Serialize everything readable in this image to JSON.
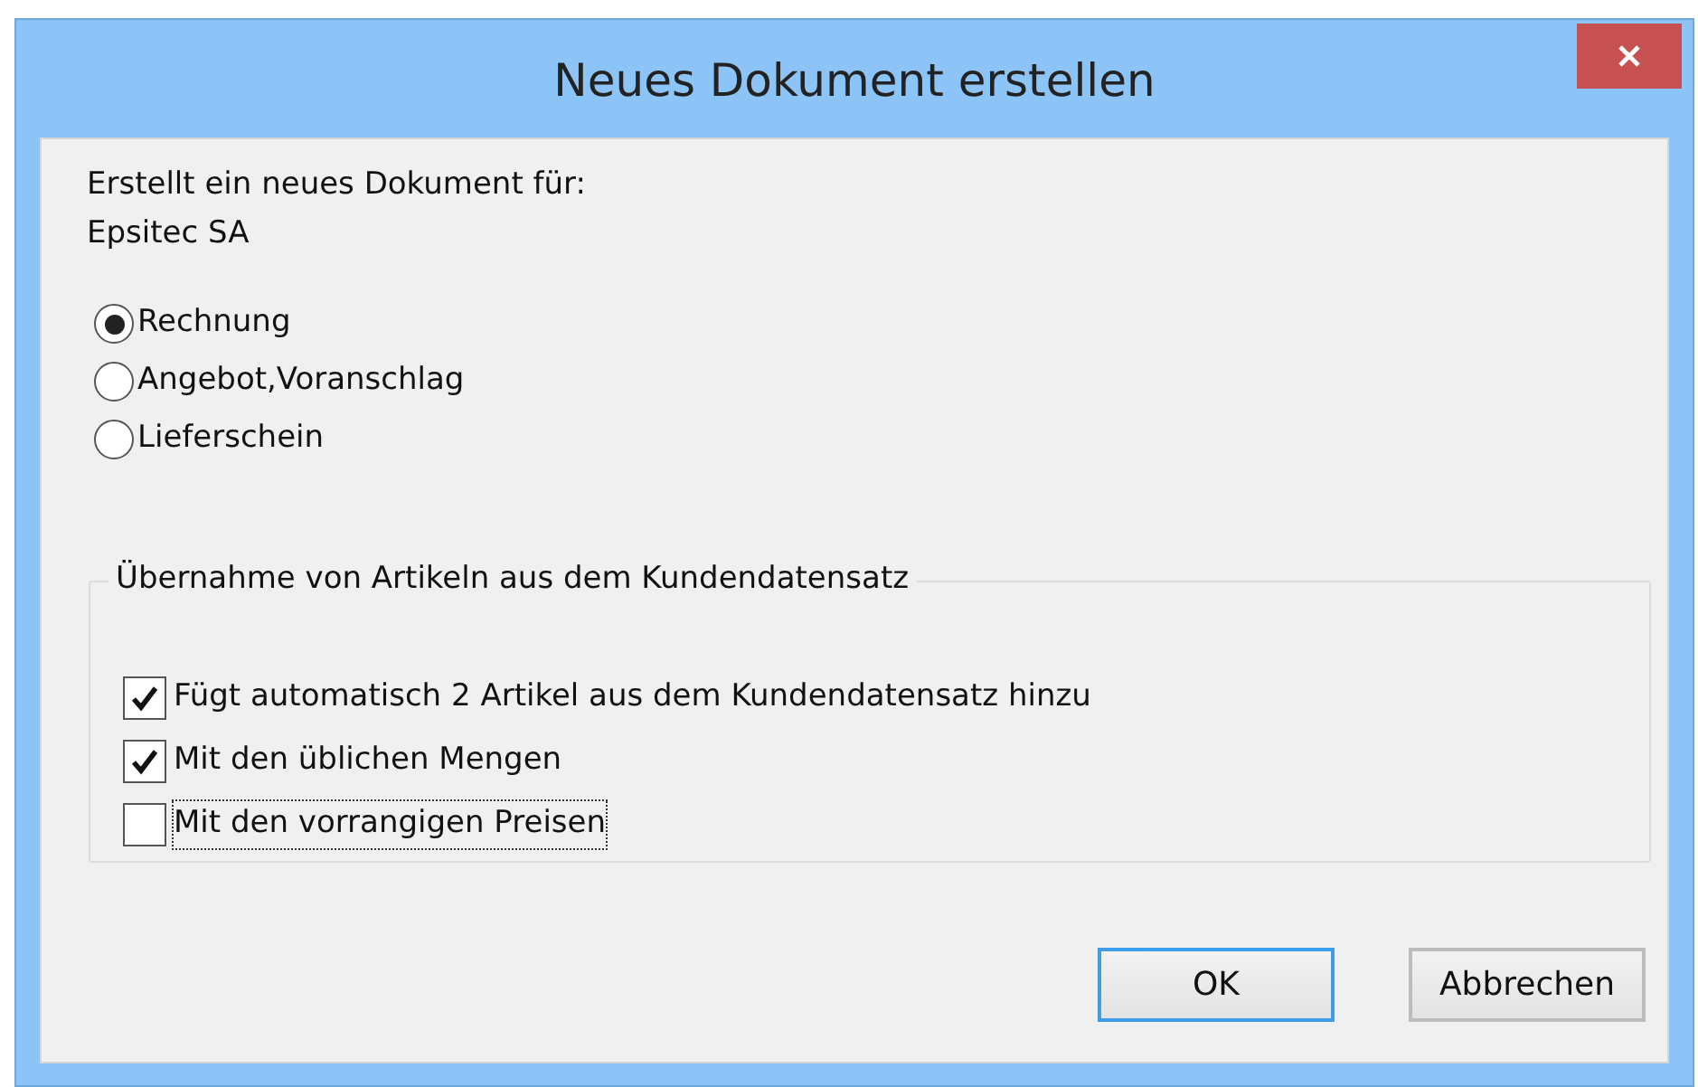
{
  "window": {
    "title": "Neues Dokument erstellen"
  },
  "intro": {
    "label": "Erstellt ein neues Dokument für:",
    "customer": "Epsitec SA"
  },
  "document_types": [
    {
      "label": "Rechnung",
      "selected": true
    },
    {
      "label": "Angebot,Voranschlag",
      "selected": false
    },
    {
      "label": "Lieferschein",
      "selected": false
    }
  ],
  "article_group": {
    "title": "Übernahme von Artikeln aus dem Kundendatensatz",
    "options": [
      {
        "label": "Fügt automatisch 2 Artikel aus dem Kundendatensatz hinzu",
        "checked": true,
        "focused": false
      },
      {
        "label": "Mit den üblichen Mengen",
        "checked": true,
        "focused": false
      },
      {
        "label": "Mit den vorrangigen Preisen",
        "checked": false,
        "focused": true
      }
    ]
  },
  "buttons": [
    {
      "label": "OK",
      "default": true
    },
    {
      "label": "Abbrechen",
      "default": false
    }
  ]
}
